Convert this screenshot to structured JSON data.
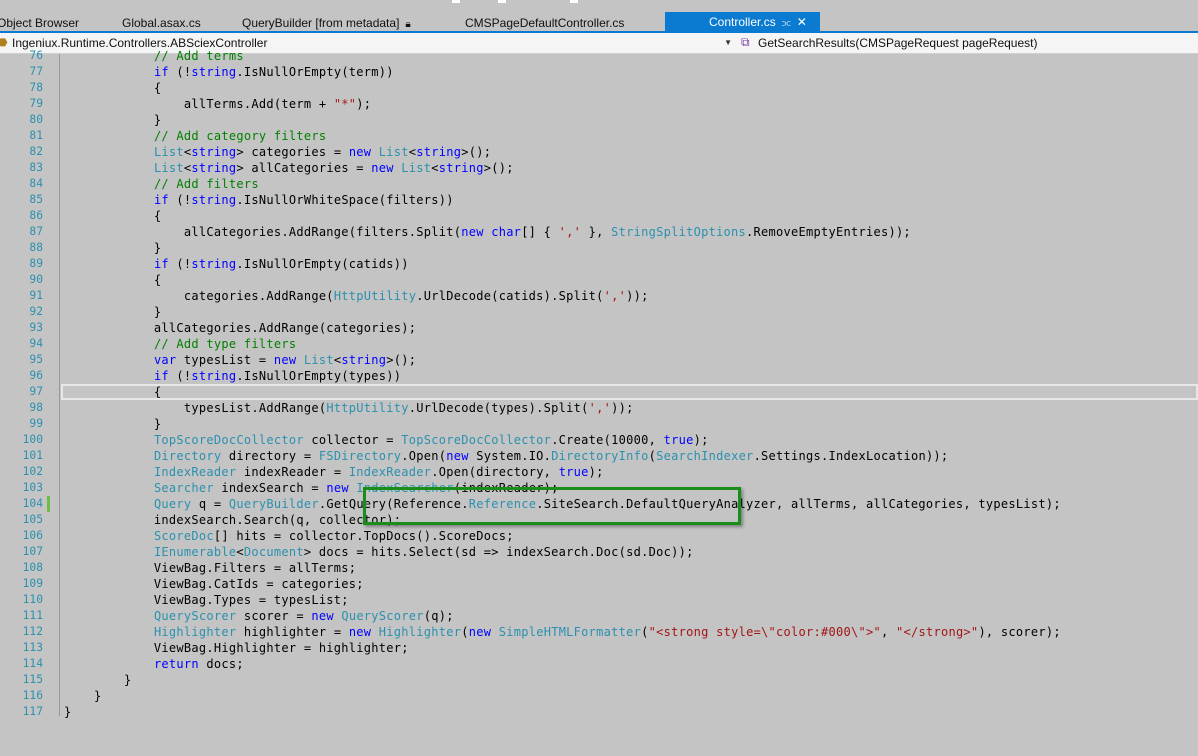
{
  "tabs": [
    {
      "label": "Object Browser",
      "active": false
    },
    {
      "label": "Global.asax.cs",
      "active": false
    },
    {
      "label": "QueryBuilder [from metadata]",
      "active": false,
      "icon": "lock-icon"
    },
    {
      "label": "CMSPageDefaultController.cs",
      "active": false
    },
    {
      "label": "Controller.cs",
      "active": true,
      "icon": "pin-icon"
    }
  ],
  "nav": {
    "class_selector": "Ingeniux.Runtime.Controllers.ABSciexController",
    "member_selector": "GetSearchResults(CMSPageRequest pageRequest)"
  },
  "colors": {
    "accent": "#0a7bd1",
    "keyword": "#0000ff",
    "type": "#2b91af",
    "string": "#a31515",
    "comment": "#008000",
    "highlight_box": "#1a8e1a"
  },
  "code_lines": [
    {
      "n": "76",
      "html": "            <span class=\"cm\">// Add terms</span>"
    },
    {
      "n": "77",
      "html": "            <span class=\"kw\">if</span> (!<span class=\"kw\">string</span>.IsNullOrEmpty(term))"
    },
    {
      "n": "78",
      "html": "            {"
    },
    {
      "n": "79",
      "html": "                allTerms.Add(term + <span class=\"st\">\"*\"</span>);"
    },
    {
      "n": "80",
      "html": "            }"
    },
    {
      "n": "81",
      "html": "            <span class=\"cm\">// Add category filters</span>"
    },
    {
      "n": "82",
      "html": "            <span class=\"ty\">List</span>&lt;<span class=\"kw\">string</span>&gt; categories = <span class=\"kw\">new</span> <span class=\"ty\">List</span>&lt;<span class=\"kw\">string</span>&gt;();"
    },
    {
      "n": "83",
      "html": "            <span class=\"ty\">List</span>&lt;<span class=\"kw\">string</span>&gt; allCategories = <span class=\"kw\">new</span> <span class=\"ty\">List</span>&lt;<span class=\"kw\">string</span>&gt;();"
    },
    {
      "n": "84",
      "html": "            <span class=\"cm\">// Add filters</span>"
    },
    {
      "n": "85",
      "html": "            <span class=\"kw\">if</span> (!<span class=\"kw\">string</span>.IsNullOrWhiteSpace(filters))"
    },
    {
      "n": "86",
      "html": "            {"
    },
    {
      "n": "87",
      "html": "                allCategories.AddRange(filters.Split(<span class=\"kw\">new</span> <span class=\"kw\">char</span>[] { <span class=\"st\">','</span> }, <span class=\"ty\">StringSplitOptions</span>.RemoveEmptyEntries));"
    },
    {
      "n": "88",
      "html": "            }"
    },
    {
      "n": "89",
      "html": "            <span class=\"kw\">if</span> (!<span class=\"kw\">string</span>.IsNullOrEmpty(catids))"
    },
    {
      "n": "90",
      "html": "            {"
    },
    {
      "n": "91",
      "html": "                categories.AddRange(<span class=\"ty\">HttpUtility</span>.UrlDecode(catids).Split(<span class=\"st\">','</span>));"
    },
    {
      "n": "92",
      "html": "            }"
    },
    {
      "n": "93",
      "html": "            allCategories.AddRange(categories);"
    },
    {
      "n": "94",
      "html": "            <span class=\"cm\">// Add type filters</span>"
    },
    {
      "n": "95",
      "html": "            <span class=\"kw\">var</span> typesList = <span class=\"kw\">new</span> <span class=\"ty\">List</span>&lt;<span class=\"kw\">string</span>&gt;();"
    },
    {
      "n": "96",
      "html": "            <span class=\"kw\">if</span> (!<span class=\"kw\">string</span>.IsNullOrEmpty(types))"
    },
    {
      "n": "97",
      "html": "            {",
      "current": true
    },
    {
      "n": "98",
      "html": "                typesList.AddRange(<span class=\"ty\">HttpUtility</span>.UrlDecode(types).Split(<span class=\"st\">','</span>));"
    },
    {
      "n": "99",
      "html": "            }"
    },
    {
      "n": "100",
      "html": "            <span class=\"ty\">TopScoreDocCollector</span> collector = <span class=\"ty\">TopScoreDocCollector</span>.Create(10000, <span class=\"kw\">true</span>);"
    },
    {
      "n": "101",
      "html": "            <span class=\"ty\">Directory</span> directory = <span class=\"ty\">FSDirectory</span>.Open(<span class=\"kw\">new</span> System.IO.<span class=\"ty\">DirectoryInfo</span>(<span class=\"ty\">SearchIndexer</span>.Settings.IndexLocation));"
    },
    {
      "n": "102",
      "html": "            <span class=\"ty\">IndexReader</span> indexReader = <span class=\"ty\">IndexReader</span>.Open(directory, <span class=\"kw\">true</span>);"
    },
    {
      "n": "103",
      "html": "            <span class=\"ty\">Searcher</span> indexSearch = <span class=\"kw\">new</span> <span class=\"ty\">IndexSearcher</span>(indexReader);"
    },
    {
      "n": "104",
      "html": "            <span class=\"ty\">Query</span> q = <span class=\"ty\">QueryBuilder</span>.GetQuery(Reference.<span class=\"ty\">Reference</span>.SiteSearch.DefaultQueryAnalyzer, allTerms, allCategories, typesList);",
      "changed": true
    },
    {
      "n": "105",
      "html": "            indexSearch.Search(q, collector);"
    },
    {
      "n": "106",
      "html": "            <span class=\"ty\">ScoreDoc</span>[] hits = collector.TopDocs().ScoreDocs;"
    },
    {
      "n": "107",
      "html": "            <span class=\"ty\">IEnumerable</span>&lt;<span class=\"ty\">Document</span>&gt; docs = hits.Select(sd =&gt; indexSearch.Doc(sd.Doc));"
    },
    {
      "n": "108",
      "html": "            ViewBag.Filters = allTerms;"
    },
    {
      "n": "109",
      "html": "            ViewBag.CatIds = categories;"
    },
    {
      "n": "110",
      "html": "            ViewBag.Types = typesList;"
    },
    {
      "n": "111",
      "html": "            <span class=\"ty\">QueryScorer</span> scorer = <span class=\"kw\">new</span> <span class=\"ty\">QueryScorer</span>(q);"
    },
    {
      "n": "112",
      "html": "            <span class=\"ty\">Highlighter</span> highlighter = <span class=\"kw\">new</span> <span class=\"ty\">Highlighter</span>(<span class=\"kw\">new</span> <span class=\"ty\">SimpleHTMLFormatter</span>(<span class=\"st\">\"&lt;strong style=\\\"color:#000\\\"&gt;\"</span>, <span class=\"st\">\"&lt;/strong&gt;\"</span>), scorer);"
    },
    {
      "n": "113",
      "html": "            ViewBag.Highlighter = highlighter;"
    },
    {
      "n": "114",
      "html": "            <span class=\"kw\">return</span> docs;"
    },
    {
      "n": "115",
      "html": "        }"
    },
    {
      "n": "116",
      "html": "    }"
    },
    {
      "n": "117",
      "html": "}"
    }
  ]
}
